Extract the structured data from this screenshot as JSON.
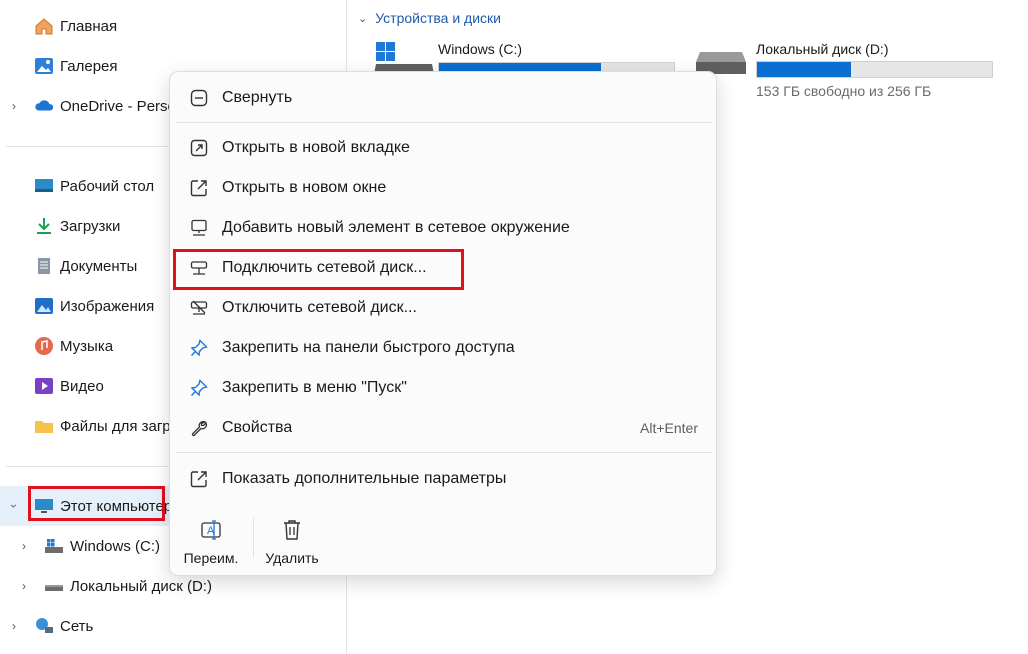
{
  "sidebar": {
    "items": [
      {
        "label": "Главная",
        "icon": "home-icon"
      },
      {
        "label": "Галерея",
        "icon": "gallery-icon"
      },
      {
        "label": "OneDrive - Personal",
        "icon": "onedrive-icon"
      },
      {
        "label": "Рабочий стол",
        "icon": "desktop-icon"
      },
      {
        "label": "Загрузки",
        "icon": "downloads-icon"
      },
      {
        "label": "Документы",
        "icon": "documents-icon"
      },
      {
        "label": "Изображения",
        "icon": "pictures-icon"
      },
      {
        "label": "Музыка",
        "icon": "music-icon"
      },
      {
        "label": "Видео",
        "icon": "videos-icon"
      },
      {
        "label": "Файлы для загрузки",
        "icon": "folder-icon"
      },
      {
        "label": "Этот компьютер",
        "icon": "this-pc-icon"
      },
      {
        "label": "Windows (C:)",
        "icon": "drive-c-icon"
      },
      {
        "label": "Локальный диск (D:)",
        "icon": "drive-icon"
      },
      {
        "label": "Сеть",
        "icon": "network-icon"
      }
    ]
  },
  "main": {
    "section_title": "Устройства и диски",
    "drives": [
      {
        "name": "Windows (C:)",
        "used_fraction": 0.69
      },
      {
        "name": "Локальный диск (D:)",
        "used_fraction": 0.4,
        "free_text": "153 ГБ свободно из 256 ГБ"
      }
    ]
  },
  "context_menu": {
    "items": [
      {
        "label": "Свернуть",
        "icon": "collapse-icon"
      },
      {
        "label": "Открыть в новой вкладке",
        "icon": "open-new-tab-icon"
      },
      {
        "label": "Открыть в новом окне",
        "icon": "open-new-window-icon"
      },
      {
        "label": "Добавить новый элемент в сетевое окружение",
        "icon": "add-network-location-icon"
      },
      {
        "label": "Подключить сетевой диск...",
        "icon": "map-network-drive-icon"
      },
      {
        "label": "Отключить сетевой диск...",
        "icon": "disconnect-network-drive-icon"
      },
      {
        "label": "Закрепить на панели быстрого доступа",
        "icon": "pin-icon"
      },
      {
        "label": "Закрепить в меню \"Пуск\"",
        "icon": "pin-start-icon"
      },
      {
        "label": "Свойства",
        "icon": "properties-icon",
        "shortcut": "Alt+Enter"
      },
      {
        "label": "Показать дополнительные параметры",
        "icon": "more-options-icon"
      }
    ],
    "quick_actions": [
      {
        "label": "Переим.",
        "icon": "rename-icon"
      },
      {
        "label": "Удалить",
        "icon": "delete-icon"
      }
    ]
  },
  "colors": {
    "accent": "#0a6fd1",
    "highlight": "#e0101c",
    "selection": "#e6f0fb"
  }
}
